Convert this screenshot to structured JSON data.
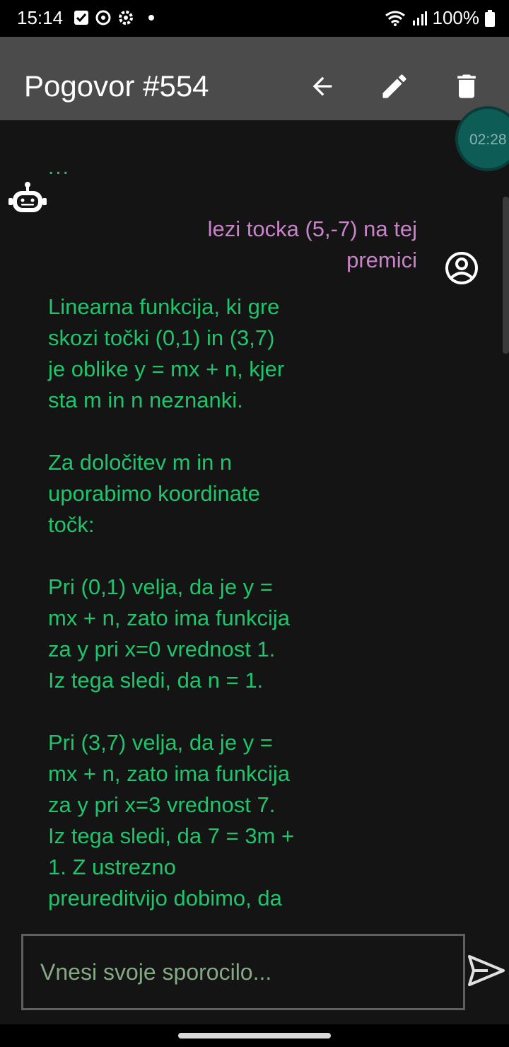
{
  "status_bar": {
    "time": "15:14",
    "battery": "100%",
    "left_icons": [
      "checkbox-icon",
      "sync-icon",
      "settings-icon",
      "dot-icon"
    ],
    "right_icons": [
      "wifi-icon",
      "signal-icon",
      "battery-icon"
    ]
  },
  "toolbar": {
    "title": "Pogovor #554",
    "actions": [
      "back-arrow-icon",
      "edit-icon",
      "delete-icon"
    ]
  },
  "timer": {
    "label": "02:28"
  },
  "chat": {
    "messages": [
      {
        "sender": "bot",
        "text": "..."
      },
      {
        "sender": "user",
        "text": "lezi tocka (5,-7) na tej\npremici"
      },
      {
        "sender": "bot",
        "text": "Linearna funkcija, ki gre\nskozi točki (0,1) in (3,7)\nje oblike y = mx + n, kjer\nsta m in n neznanki.\n\nZa določitev m in n\nuporabimo koordinate\ntočk:\n\nPri (0,1) velja, da je y =\nmx + n, zato ima funkcija\nza y pri x=0 vrednost 1.\nIz tega sledi, da n = 1.\n\nPri (3,7) velja, da je y =\nmx + n, zato ima funkcija\nza y pri x=3 vrednost 7.\nIz tega sledi, da 7 = 3m +\n1. Z ustrezno\npreureditvijo dobimo, da"
      }
    ]
  },
  "input": {
    "placeholder": "Vnesi svoje sporocilo...",
    "value": ""
  },
  "colors": {
    "background": "#141414",
    "toolbar": "#4b4b4b",
    "bot_text": "#1fc46b",
    "user_text": "#c983c9",
    "timer_bg": "#0d5c55"
  }
}
